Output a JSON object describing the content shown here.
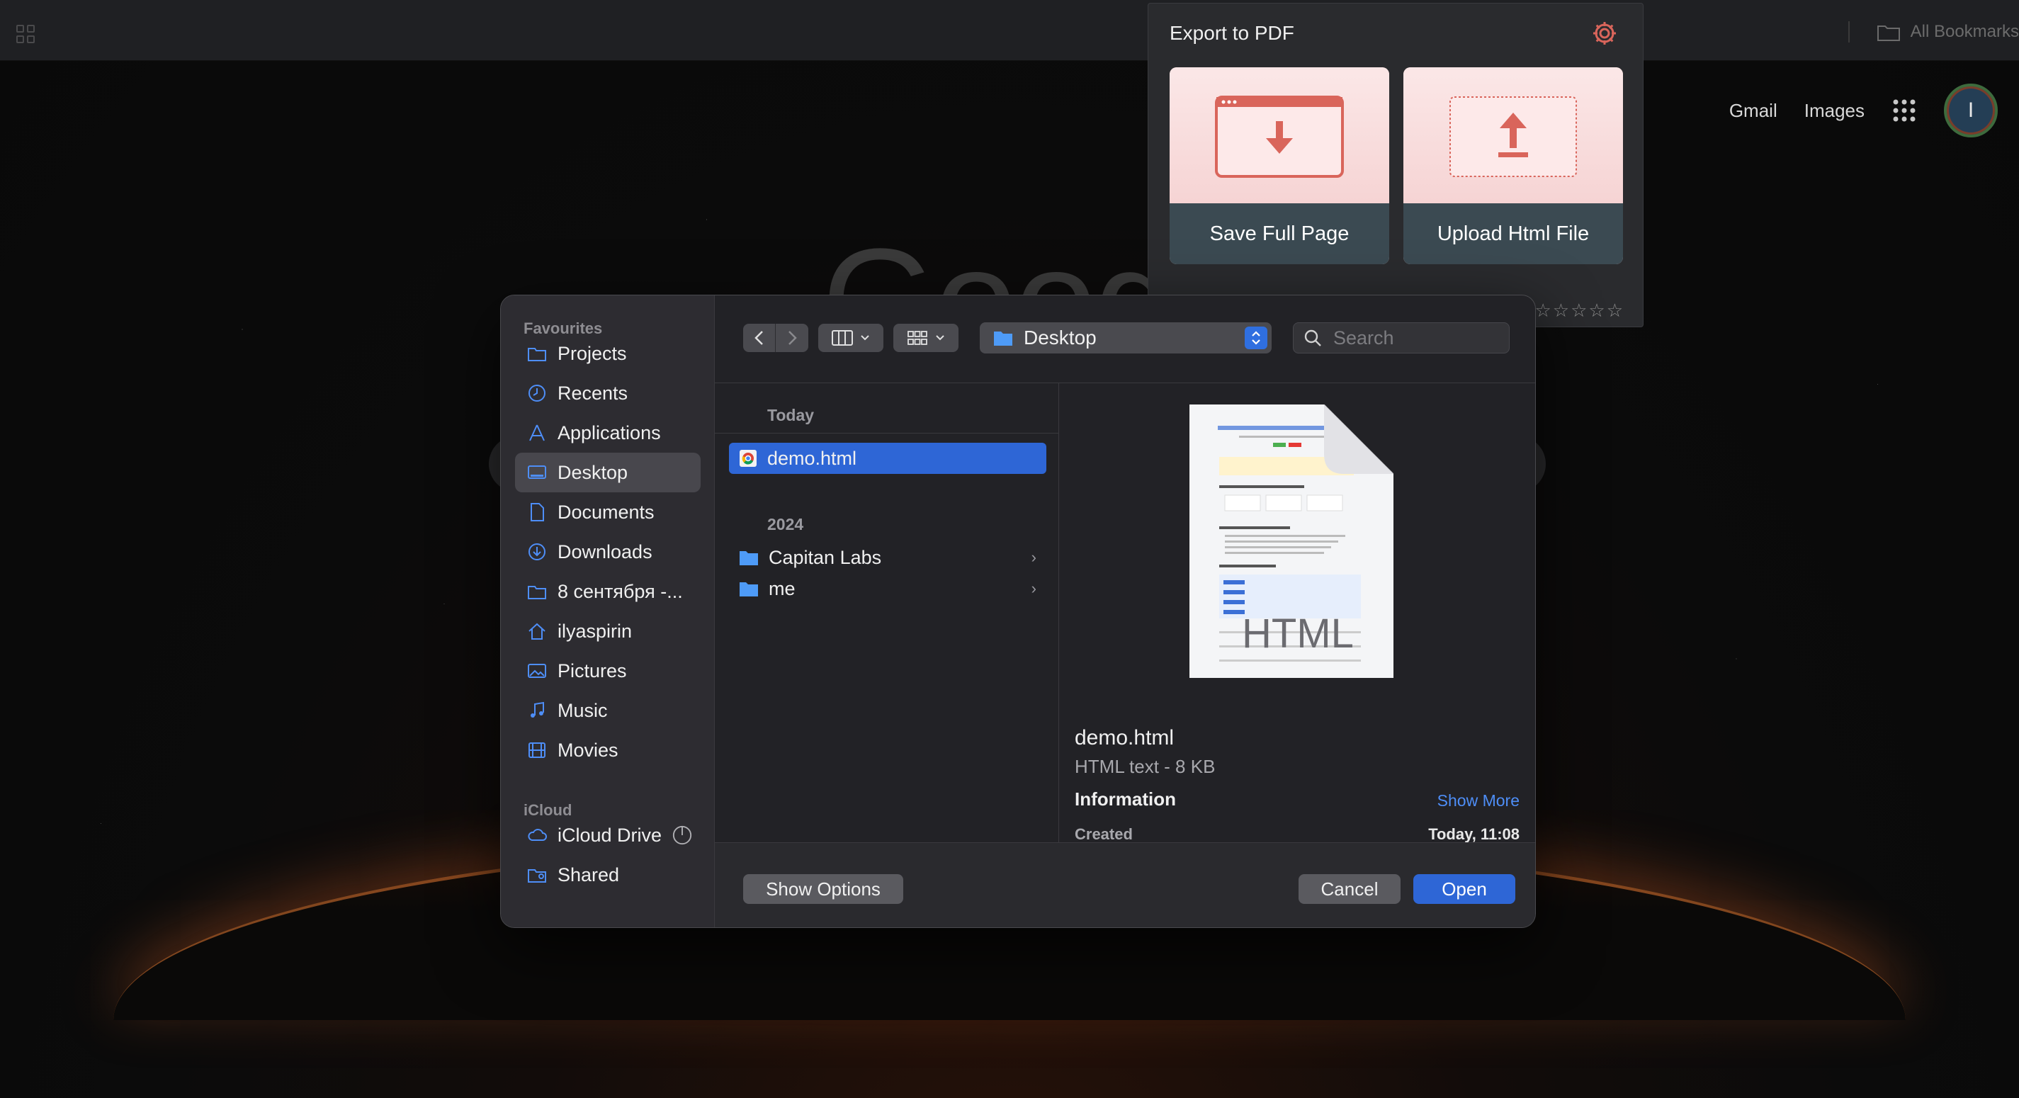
{
  "browser": {
    "bookmarks_label": "All Bookmarks"
  },
  "google": {
    "header_links": [
      "Gmail",
      "Images"
    ],
    "avatar_initial": "I",
    "logo_text": "Googl"
  },
  "export_popup": {
    "title": "Export to PDF",
    "cards": [
      {
        "label": "Save Full Page",
        "icon": "download-arrow-icon"
      },
      {
        "label": "Upload Html File",
        "icon": "upload-arrow-icon"
      }
    ],
    "rating_stars": "☆☆☆☆☆",
    "accent_color": "#d9655b"
  },
  "dialog": {
    "sidebar": {
      "favourites_title": "Favourites",
      "favourites": [
        {
          "label": "Projects",
          "icon": "folder-icon"
        },
        {
          "label": "Recents",
          "icon": "clock-icon"
        },
        {
          "label": "Applications",
          "icon": "applications-icon"
        },
        {
          "label": "Desktop",
          "icon": "desktop-icon",
          "selected": true
        },
        {
          "label": "Documents",
          "icon": "document-icon"
        },
        {
          "label": "Downloads",
          "icon": "download-icon"
        },
        {
          "label": "8 сентября -...",
          "icon": "folder-icon"
        },
        {
          "label": "ilyaspirin",
          "icon": "home-icon"
        },
        {
          "label": "Pictures",
          "icon": "pictures-icon"
        },
        {
          "label": "Music",
          "icon": "music-icon"
        },
        {
          "label": "Movies",
          "icon": "movies-icon"
        }
      ],
      "icloud_title": "iCloud",
      "icloud": [
        {
          "label": "iCloud Drive",
          "icon": "cloud-icon"
        },
        {
          "label": "Shared",
          "icon": "shared-folder-icon"
        }
      ]
    },
    "toolbar": {
      "location": "Desktop",
      "search_placeholder": "Search"
    },
    "files": {
      "groups": [
        {
          "title": "Today",
          "items": [
            {
              "name": "demo.html",
              "type": "html",
              "selected": true
            }
          ]
        },
        {
          "title": "2024",
          "items": [
            {
              "name": "Capitan Labs",
              "type": "folder"
            },
            {
              "name": "me",
              "type": "folder"
            }
          ]
        }
      ]
    },
    "preview": {
      "thumb_label": "HTML",
      "name": "demo.html",
      "kind": "HTML text - 8 KB",
      "info_title": "Information",
      "show_more": "Show More",
      "created_label": "Created",
      "created_value": "Today, 11:08"
    },
    "buttons": {
      "show_options": "Show Options",
      "cancel": "Cancel",
      "open": "Open"
    },
    "accent_color": "#2e66d6"
  }
}
